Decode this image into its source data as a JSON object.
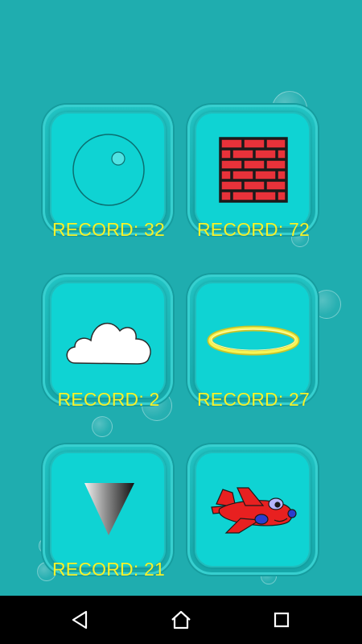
{
  "levels": [
    {
      "icon": "ball-icon",
      "record_label": "RECORD: 32"
    },
    {
      "icon": "brick-wall-icon",
      "record_label": "RECORD: 72"
    },
    {
      "icon": "cloud-icon",
      "record_label": "RECORD: 2"
    },
    {
      "icon": "halo-ring-icon",
      "record_label": "RECORD: 27"
    },
    {
      "icon": "inverted-triangle-icon",
      "record_label": "RECORD: 21"
    },
    {
      "icon": "airplane-icon",
      "record_label": ""
    }
  ],
  "navbar": {
    "back": "back-icon",
    "home": "home-icon",
    "recents": "recents-icon"
  },
  "colors": {
    "background": "#1fadaf",
    "tile": "#0fd3d3",
    "record_text": "#f4f22c",
    "brick": "#e8323a",
    "navbar": "#000000"
  }
}
